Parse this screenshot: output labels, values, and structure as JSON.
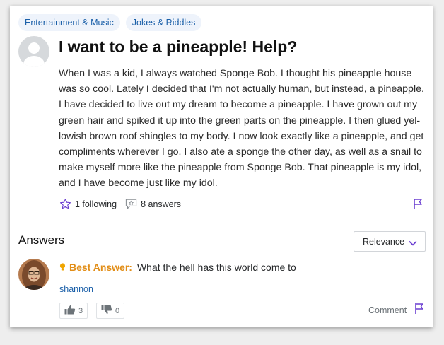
{
  "tags": [
    "Entertainment & Music",
    "Jokes & Riddles"
  ],
  "question": {
    "title": "I want to be a pineapple! Help?",
    "lines": [
      "When I was a kid, I always watched Sponge Bob. I thought his pineapple house",
      "was so cool. Lately I decided that I'm not actually human, but instead, a pineapple.",
      "I have decided to live out my dream to become a pineapple. I have grown out my",
      "green hair and spiked it up into the green parts on the pineapple. I then glued yel-",
      "lowish brown roof shingles to my body. I now look exactly like a pineapple, and get",
      "compliments wherever I go. I also ate a sponge the other day, as well as a snail to",
      "make myself more like the pineapple from Sponge Bob. That pineapple is my idol,",
      "and I have become just like my idol."
    ],
    "following": "1 following",
    "answers_count": "8 answers"
  },
  "answers": {
    "heading": "Answers",
    "sort_label": "Relevance",
    "best_label": "Best Answer:",
    "best_text": "What the hell has this world come to",
    "username": "shannon",
    "thumbs_up": "3",
    "thumbs_down": "0",
    "comment_label": "Comment"
  },
  "colors": {
    "link": "#1a5fa8",
    "best": "#e28e18",
    "flag": "#6b3fd1",
    "tag_bg": "#eef3fb"
  },
  "icons": [
    "star-icon",
    "answers-icon",
    "flag-icon",
    "chevron-down-icon",
    "lightbulb-icon",
    "thumbs-up-icon",
    "thumbs-down-icon"
  ]
}
